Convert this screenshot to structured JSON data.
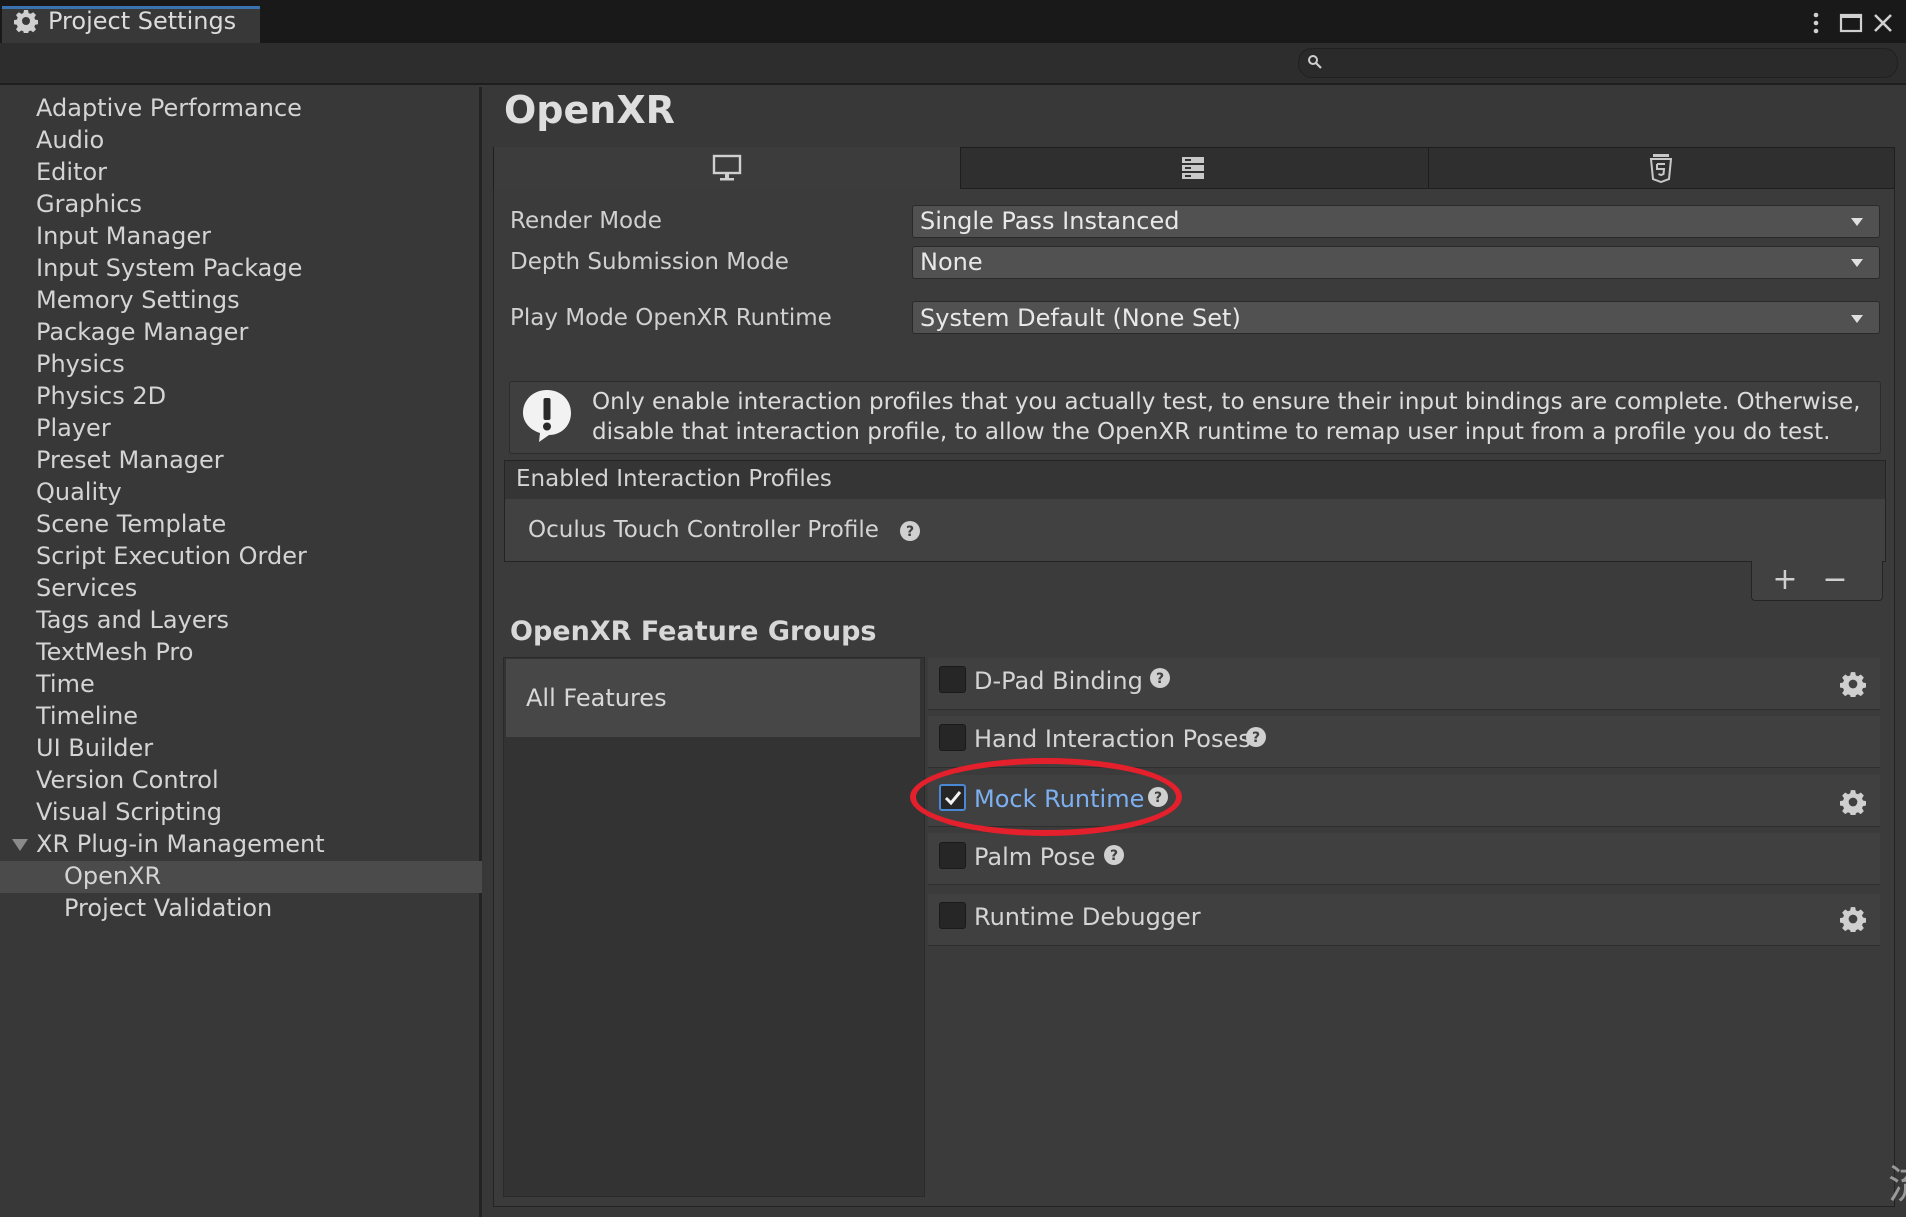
{
  "window": {
    "tab_title": "Project Settings",
    "icons": [
      "gear-icon",
      "more-icon",
      "maximize-icon",
      "close-icon"
    ]
  },
  "search": {
    "placeholder": ""
  },
  "sidebar": {
    "items": [
      {
        "label": "Adaptive Performance"
      },
      {
        "label": "Audio"
      },
      {
        "label": "Editor"
      },
      {
        "label": "Graphics"
      },
      {
        "label": "Input Manager"
      },
      {
        "label": "Input System Package"
      },
      {
        "label": "Memory Settings"
      },
      {
        "label": "Package Manager"
      },
      {
        "label": "Physics"
      },
      {
        "label": "Physics 2D"
      },
      {
        "label": "Player"
      },
      {
        "label": "Preset Manager"
      },
      {
        "label": "Quality"
      },
      {
        "label": "Scene Template"
      },
      {
        "label": "Script Execution Order"
      },
      {
        "label": "Services"
      },
      {
        "label": "Tags and Layers"
      },
      {
        "label": "TextMesh Pro"
      },
      {
        "label": "Time"
      },
      {
        "label": "Timeline"
      },
      {
        "label": "UI Builder"
      },
      {
        "label": "Version Control"
      },
      {
        "label": "Visual Scripting"
      },
      {
        "label": "XR Plug-in Management",
        "expanded": true
      },
      {
        "label": "OpenXR",
        "child": true,
        "selected": true
      },
      {
        "label": "Project Validation",
        "child": true
      }
    ]
  },
  "main": {
    "title": "OpenXR",
    "platform_tabs": [
      {
        "icon": "desktop-icon",
        "active": true
      },
      {
        "icon": "server-icon",
        "active": false
      },
      {
        "icon": "html5-icon",
        "active": false
      }
    ],
    "fields": {
      "render_mode": {
        "label": "Render Mode",
        "value": "Single Pass Instanced"
      },
      "depth_submission": {
        "label": "Depth Submission Mode",
        "value": "None"
      },
      "play_mode_runtime": {
        "label": "Play Mode OpenXR Runtime",
        "value": "System Default (None Set)"
      }
    },
    "help_box": {
      "icon": "warning-icon",
      "line1": "Only enable interaction profiles that you actually test, to ensure their input bindings are complete. Otherwise,",
      "line2": "disable that interaction profile, to allow the OpenXR runtime to remap user input from a profile you do test."
    },
    "interaction_profiles": {
      "header": "Enabled Interaction Profiles",
      "items": [
        "Oculus Touch Controller Profile"
      ],
      "add_label": "+",
      "remove_label": "−"
    },
    "feature_groups": {
      "title": "OpenXR Feature Groups",
      "groups": [
        "All Features"
      ],
      "features": [
        {
          "label": "D-Pad Binding",
          "checked": false,
          "has_settings": true
        },
        {
          "label": "Hand Interaction Poses",
          "checked": false,
          "has_settings": false
        },
        {
          "label": "Mock Runtime",
          "checked": true,
          "has_settings": true
        },
        {
          "label": "Palm Pose",
          "checked": false,
          "has_settings": false
        },
        {
          "label": "Runtime Debugger",
          "checked": false,
          "has_settings": true
        }
      ]
    },
    "highlight_color": "#e3202b",
    "accent_color": "#4a88d6"
  },
  "corner_glyph": "流"
}
